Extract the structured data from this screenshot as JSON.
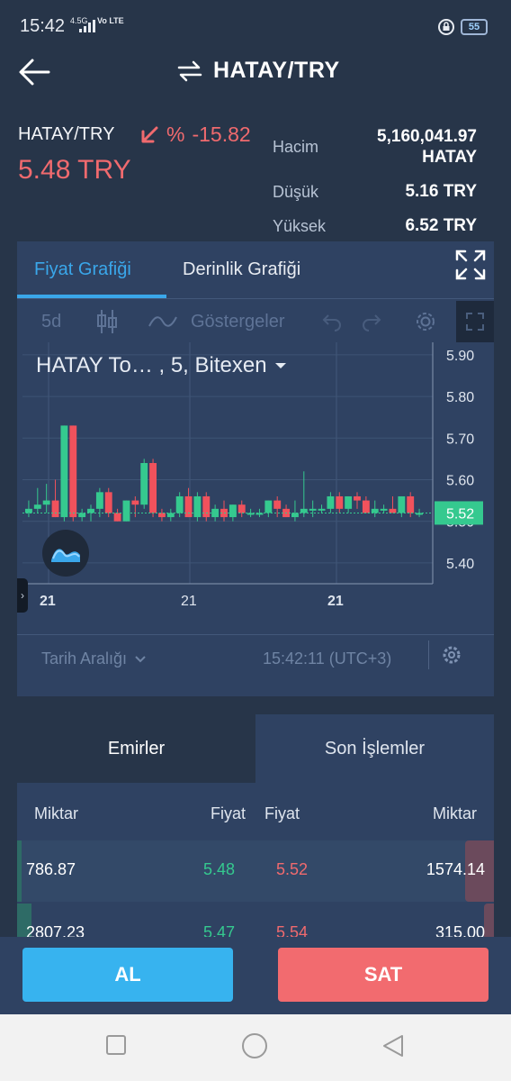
{
  "status": {
    "time": "15:42",
    "network": "4.5G",
    "volte": "Vo LTE",
    "battery": "55"
  },
  "header": {
    "title": "HATAY/TRY"
  },
  "ticker": {
    "pair": "HATAY/TRY",
    "change_prefix": "%",
    "change": "-15.82",
    "price": "5.48 TRY",
    "accent_down": "#f06a6e",
    "accent_up": "#35c98f"
  },
  "stats": {
    "volume_label": "Hacim",
    "volume_value": "5,160,041.97",
    "volume_unit": "HATAY",
    "low_label": "Düşük",
    "low_value": "5.16 TRY",
    "high_label": "Yüksek",
    "high_value": "6.52 TRY"
  },
  "chart_tabs": {
    "price_chart": "Fiyat Grafiği",
    "depth_chart": "Derinlik Grafiği"
  },
  "chart_toolbar": {
    "interval": "5d",
    "indicators": "Göstergeler"
  },
  "chart_legend": {
    "title": "HATAY To… , 5, Bitexen"
  },
  "chart_footer": {
    "range": "Tarih Aralığı",
    "clock": "15:42:11 (UTC+3)"
  },
  "chart_data": {
    "type": "candlestick",
    "ylim": [
      5.35,
      5.93
    ],
    "y_ticks": [
      "5.90",
      "5.80",
      "5.70",
      "5.60",
      "5.50",
      "5.40"
    ],
    "x_ticks": [
      "21",
      "21",
      "21"
    ],
    "last_price": "5.52",
    "up_color": "#35c98f",
    "down_color": "#f0525c",
    "candles": [
      {
        "o": 5.52,
        "h": 5.55,
        "l": 5.51,
        "c": 5.53
      },
      {
        "o": 5.53,
        "h": 5.58,
        "l": 5.52,
        "c": 5.54
      },
      {
        "o": 5.54,
        "h": 5.59,
        "l": 5.52,
        "c": 5.55
      },
      {
        "o": 5.55,
        "h": 5.6,
        "l": 5.51,
        "c": 5.51
      },
      {
        "o": 5.51,
        "h": 5.73,
        "l": 5.5,
        "c": 5.73
      },
      {
        "o": 5.73,
        "h": 5.73,
        "l": 5.5,
        "c": 5.51
      },
      {
        "o": 5.51,
        "h": 5.53,
        "l": 5.5,
        "c": 5.52
      },
      {
        "o": 5.52,
        "h": 5.54,
        "l": 5.5,
        "c": 5.53
      },
      {
        "o": 5.53,
        "h": 5.58,
        "l": 5.51,
        "c": 5.57
      },
      {
        "o": 5.57,
        "h": 5.58,
        "l": 5.51,
        "c": 5.52
      },
      {
        "o": 5.52,
        "h": 5.53,
        "l": 5.5,
        "c": 5.5
      },
      {
        "o": 5.5,
        "h": 5.55,
        "l": 5.5,
        "c": 5.55
      },
      {
        "o": 5.55,
        "h": 5.56,
        "l": 5.51,
        "c": 5.54
      },
      {
        "o": 5.54,
        "h": 5.65,
        "l": 5.53,
        "c": 5.64
      },
      {
        "o": 5.64,
        "h": 5.65,
        "l": 5.51,
        "c": 5.52
      },
      {
        "o": 5.52,
        "h": 5.53,
        "l": 5.5,
        "c": 5.51
      },
      {
        "o": 5.51,
        "h": 5.53,
        "l": 5.5,
        "c": 5.52
      },
      {
        "o": 5.52,
        "h": 5.57,
        "l": 5.51,
        "c": 5.56
      },
      {
        "o": 5.56,
        "h": 5.58,
        "l": 5.51,
        "c": 5.51
      },
      {
        "o": 5.51,
        "h": 5.57,
        "l": 5.5,
        "c": 5.56
      },
      {
        "o": 5.56,
        "h": 5.57,
        "l": 5.5,
        "c": 5.51
      },
      {
        "o": 5.51,
        "h": 5.54,
        "l": 5.5,
        "c": 5.53
      },
      {
        "o": 5.53,
        "h": 5.55,
        "l": 5.5,
        "c": 5.51
      },
      {
        "o": 5.51,
        "h": 5.54,
        "l": 5.5,
        "c": 5.54
      },
      {
        "o": 5.54,
        "h": 5.55,
        "l": 5.51,
        "c": 5.52
      },
      {
        "o": 5.52,
        "h": 5.53,
        "l": 5.51,
        "c": 5.52
      },
      {
        "o": 5.52,
        "h": 5.53,
        "l": 5.51,
        "c": 5.52
      },
      {
        "o": 5.52,
        "h": 5.55,
        "l": 5.51,
        "c": 5.55
      },
      {
        "o": 5.55,
        "h": 5.56,
        "l": 5.51,
        "c": 5.53
      },
      {
        "o": 5.53,
        "h": 5.54,
        "l": 5.51,
        "c": 5.51
      },
      {
        "o": 5.51,
        "h": 5.55,
        "l": 5.5,
        "c": 5.52
      },
      {
        "o": 5.52,
        "h": 5.62,
        "l": 5.51,
        "c": 5.53
      },
      {
        "o": 5.53,
        "h": 5.55,
        "l": 5.51,
        "c": 5.53
      },
      {
        "o": 5.53,
        "h": 5.54,
        "l": 5.52,
        "c": 5.53
      },
      {
        "o": 5.53,
        "h": 5.57,
        "l": 5.52,
        "c": 5.56
      },
      {
        "o": 5.56,
        "h": 5.57,
        "l": 5.52,
        "c": 5.53
      },
      {
        "o": 5.53,
        "h": 5.56,
        "l": 5.52,
        "c": 5.56
      },
      {
        "o": 5.56,
        "h": 5.57,
        "l": 5.53,
        "c": 5.55
      },
      {
        "o": 5.55,
        "h": 5.56,
        "l": 5.52,
        "c": 5.52
      },
      {
        "o": 5.52,
        "h": 5.55,
        "l": 5.51,
        "c": 5.53
      },
      {
        "o": 5.53,
        "h": 5.54,
        "l": 5.52,
        "c": 5.53
      },
      {
        "o": 5.53,
        "h": 5.56,
        "l": 5.52,
        "c": 5.52
      },
      {
        "o": 5.52,
        "h": 5.56,
        "l": 5.51,
        "c": 5.56
      },
      {
        "o": 5.56,
        "h": 5.57,
        "l": 5.51,
        "c": 5.52
      },
      {
        "o": 5.52,
        "h": 5.53,
        "l": 5.51,
        "c": 5.52
      }
    ]
  },
  "orders_tabs": {
    "orders": "Emirler",
    "trades": "Son İşlemler"
  },
  "orderbook": {
    "headers": {
      "bid_amount": "Miktar",
      "bid_price": "Fiyat",
      "ask_price": "Fiyat",
      "ask_amount": "Miktar"
    },
    "rows": [
      {
        "bid_amount": "786.87",
        "bid_price": "5.48",
        "ask_price": "5.52",
        "ask_amount": "1574.14",
        "bid_depth": 0.01,
        "ask_depth": 0.06
      },
      {
        "bid_amount": "2807.23",
        "bid_price": "5.47",
        "ask_price": "5.54",
        "ask_amount": "315.00",
        "bid_depth": 0.03,
        "ask_depth": 0.02
      }
    ]
  },
  "actions": {
    "buy": "AL",
    "sell": "SAT"
  }
}
